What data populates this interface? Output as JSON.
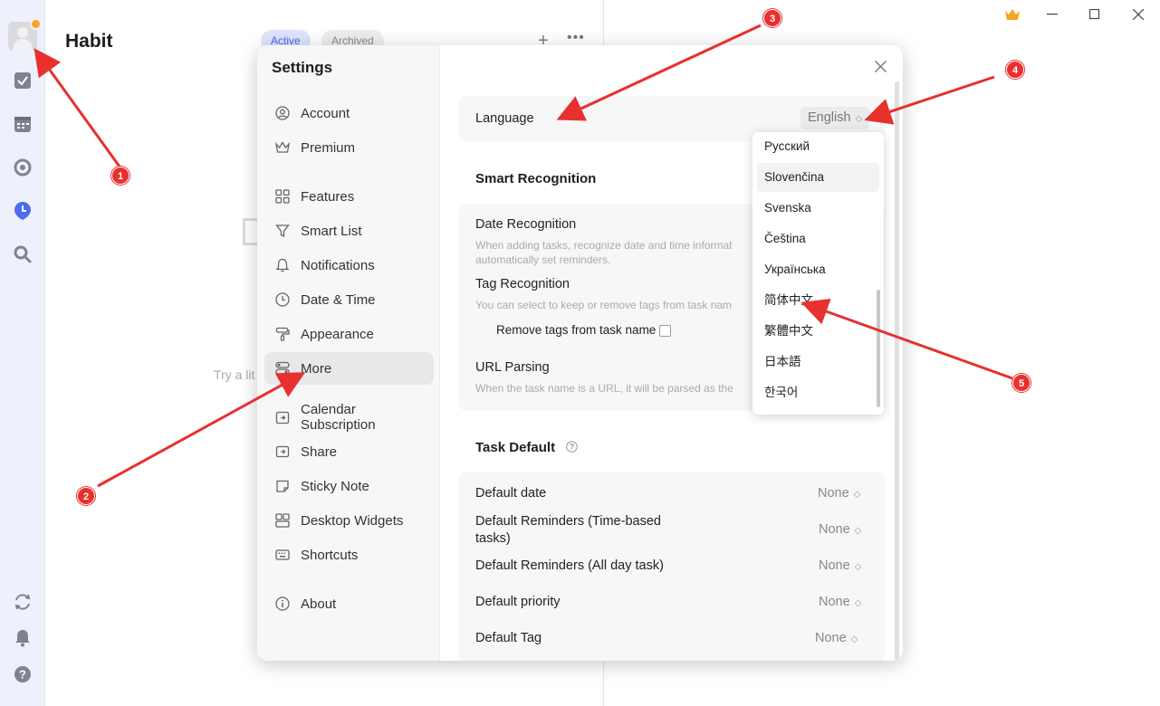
{
  "app": {
    "view_title": "Habit",
    "tabs": [
      "Active",
      "Archived"
    ],
    "hint": "Try a lit"
  },
  "rail": {
    "icons": [
      "avatar-icon",
      "checkbox-icon",
      "calendar-icon",
      "focus-icon",
      "habit-icon",
      "search-icon",
      "sync-icon",
      "bell-icon",
      "help-icon"
    ]
  },
  "settings": {
    "title": "Settings",
    "nav": [
      "Account",
      "Premium",
      "Features",
      "Smart List",
      "Notifications",
      "Date & Time",
      "Appearance",
      "More",
      "Calendar Subscription",
      "Share",
      "Sticky Note",
      "Desktop Widgets",
      "Shortcuts",
      "About"
    ],
    "selected": "More",
    "language": {
      "label": "Language",
      "value": "English"
    },
    "smart_recognition": {
      "heading": "Smart Recognition",
      "date_label": "Date Recognition",
      "date_desc_1": "When adding tasks, recognize date and time informat",
      "date_desc_2": "automatically set reminders.",
      "tag_label": "Tag Recognition",
      "tag_desc": "You can select to keep or remove tags from task nam",
      "remove_tags": "Remove tags from task name",
      "url_label": "URL Parsing",
      "url_desc": "When the task name is a URL, it will be parsed as the"
    },
    "task_default": {
      "heading": "Task Default",
      "rows": [
        {
          "label": "Default date",
          "value": "None"
        },
        {
          "label": "Default Reminders (Time-based",
          "label2": "tasks)",
          "value": "None"
        },
        {
          "label": "Default Reminders (All day task)",
          "value": "None"
        },
        {
          "label": "Default priority",
          "value": "None"
        },
        {
          "label": "Default Tag",
          "value": "None"
        }
      ]
    }
  },
  "language_dropdown": {
    "options": [
      "Русский",
      "Slovenčina",
      "Svenska",
      "Čeština",
      "Українська",
      "简体中文",
      "繁體中文",
      "日本語",
      "한국어"
    ],
    "highlighted": "Slovenčina"
  },
  "annotations": [
    "1",
    "2",
    "3",
    "4",
    "5"
  ],
  "colors": {
    "accent": "#4a6cf0",
    "annotation": "#e8302f",
    "premium": "#f5a623"
  }
}
